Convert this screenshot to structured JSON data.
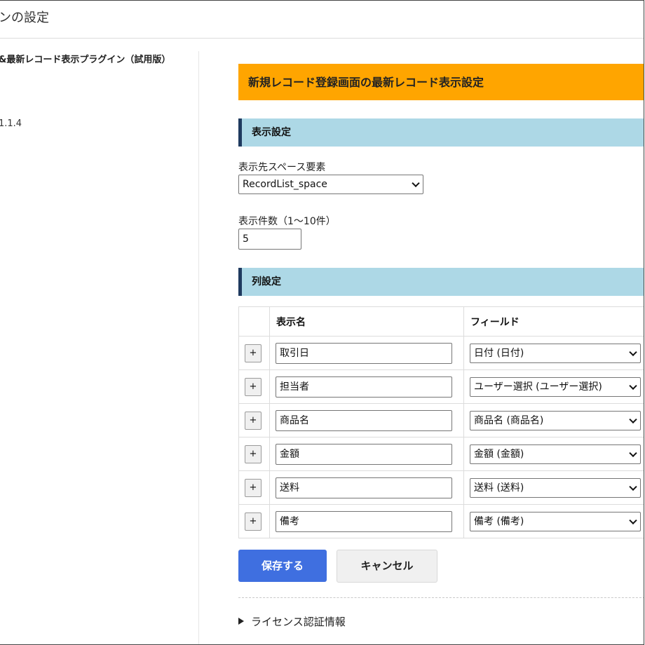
{
  "page": {
    "title": "ンの設定"
  },
  "sidebar": {
    "plugin_name": "&最新レコード表示プラグイン（試用版）",
    "version": "1.1.4"
  },
  "banner": {
    "title": "新規レコード登録画面の最新レコード表示設定"
  },
  "display_settings": {
    "heading": "表示設定",
    "space_label": "表示先スペース要素",
    "space_value": "RecordList_space",
    "count_label": "表示件数（1〜10件）",
    "count_value": "5"
  },
  "column_settings": {
    "heading": "列設定",
    "headers": [
      "",
      "表示名",
      "フィールド"
    ],
    "add_label": "+",
    "rows": [
      {
        "name": "取引日",
        "field": "日付 (日付)"
      },
      {
        "name": "担当者",
        "field": "ユーザー選択 (ユーザー選択)"
      },
      {
        "name": "商品名",
        "field": "商品名 (商品名)"
      },
      {
        "name": "金額",
        "field": "金額 (金額)"
      },
      {
        "name": "送料",
        "field": "送料 (送料)"
      },
      {
        "name": "備考",
        "field": "備考 (備考)"
      }
    ]
  },
  "actions": {
    "save_label": "保存する",
    "cancel_label": "キャンセル"
  },
  "license": {
    "toggle_label": "ライセンス認証情報"
  },
  "colors": {
    "banner": "#ffa500",
    "section_header": "#add8e6",
    "section_accent": "#1f3a5f",
    "primary_button": "#3f6fe0"
  }
}
